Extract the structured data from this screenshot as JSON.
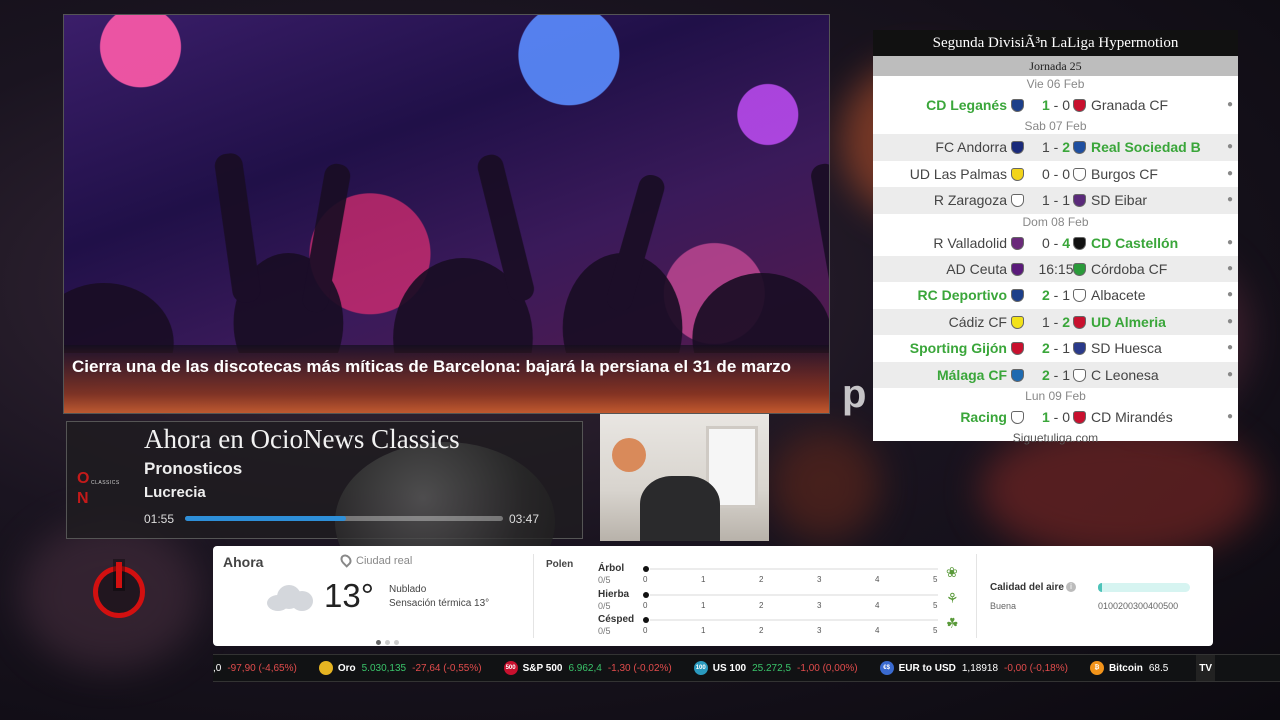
{
  "hero": {
    "headline": "Cierra una de las discotecas más míticas de Barcelona: bajará la persiana el 31 de marzo"
  },
  "now_playing": {
    "title": "Ahora en OcioNews Classics",
    "show": "Pronosticos",
    "host": "Lucrecia",
    "current_time": "01:55",
    "duration": "03:47",
    "progress_fraction": 0.506,
    "logo_o": "O",
    "logo_n": "N",
    "logo_classics": "CLASSICS"
  },
  "side_letter": "p",
  "laliga": {
    "title": "Segunda DivisiÃ³n LaLiga Hypermotion",
    "round": "Jornada 25",
    "footer": "Siguetuliga.com",
    "days": [
      {
        "date": "Vie 06 Feb",
        "matches": [
          {
            "home": "CD Leganés",
            "score": "1 - 0",
            "away": "Granada CF",
            "winner": "home",
            "home_color": "#1c3f8a",
            "away_color": "#c8102e"
          }
        ]
      },
      {
        "date": "Sab 07 Feb",
        "matches": [
          {
            "home": "FC Andorra",
            "score": "1 - 2",
            "away": "Real Sociedad B",
            "winner": "away",
            "home_color": "#1a2a7a",
            "away_color": "#1f4fa0"
          },
          {
            "home": "UD Las Palmas",
            "score": "0 - 0",
            "away": "Burgos CF",
            "winner": "none",
            "home_color": "#f2d41a",
            "away_color": "#ffffff"
          },
          {
            "home": "R Zaragoza",
            "score": "1 - 1",
            "away": "SD Eibar",
            "winner": "none",
            "home_color": "#ffffff",
            "away_color": "#5a2a7a"
          }
        ]
      },
      {
        "date": "Dom 08 Feb",
        "matches": [
          {
            "home": "R Valladolid",
            "score": "0 - 4",
            "away": "CD Castellón",
            "winner": "away",
            "home_color": "#6a2a7a",
            "away_color": "#111111"
          },
          {
            "home": "AD Ceuta",
            "score": "16:15",
            "away": "Córdoba CF",
            "winner": "none",
            "home_color": "#5a1a7a",
            "away_color": "#2a9a3a"
          },
          {
            "home": "RC Deportivo",
            "score": "2 - 1",
            "away": "Albacete",
            "winner": "home",
            "home_color": "#1c3f8a",
            "away_color": "#ffffff"
          },
          {
            "home": "Cádiz CF",
            "score": "1 - 2",
            "away": "UD Almeria",
            "winner": "away",
            "home_color": "#f2e21a",
            "away_color": "#c8102e"
          },
          {
            "home": "Sporting Gijón",
            "score": "2 - 1",
            "away": "SD Huesca",
            "winner": "home",
            "home_color": "#c8102e",
            "away_color": "#2a3a8a"
          },
          {
            "home": "Málaga CF",
            "score": "2 - 1",
            "away": "C Leonesa",
            "winner": "home",
            "home_color": "#1f6ab0",
            "away_color": "#ffffff"
          }
        ]
      },
      {
        "date": "Lun 09 Feb",
        "matches": [
          {
            "home": "Racing",
            "score": "1 - 0",
            "away": "CD Mirandés",
            "winner": "home",
            "home_color": "#ffffff",
            "away_color": "#c8102e"
          }
        ]
      }
    ]
  },
  "weather": {
    "now_label": "Ahora",
    "city": "Ciudad real",
    "temperature": "13°",
    "condition": "Nublado",
    "feels_like": "Sensación térmica 13°",
    "pollen_label": "Polen",
    "pollen": [
      {
        "name": "Árbol",
        "level": "0/5",
        "icon": "tree-icon"
      },
      {
        "name": "Hierba",
        "level": "0/5",
        "icon": "herb-icon"
      },
      {
        "name": "Césped",
        "level": "0/5",
        "icon": "grass-icon"
      }
    ],
    "pollen_ticks": [
      "0",
      "1",
      "2",
      "3",
      "4",
      "5"
    ],
    "air_quality_label": "Calidad del aire",
    "air_quality_value": "Buena",
    "air_scale": "0100200300400500",
    "info_glyph": "i"
  },
  "ticker": [
    {
      "name": "",
      "value": ",0",
      "change": "-97,90 (-4,65%)",
      "icon": "",
      "value_color": "white"
    },
    {
      "name": "Oro",
      "value": "5.030,135",
      "change": "-27,64 (-0,55%)",
      "icon": "gold-icon",
      "icon_text": "",
      "icon_color": "#e6b422",
      "value_color": "green"
    },
    {
      "name": "S&P 500",
      "value": "6.962,4",
      "change": "-1,30 (-0,02%)",
      "icon": "sp500-icon",
      "icon_text": "500",
      "icon_color": "#c8102e",
      "value_color": "green"
    },
    {
      "name": "US 100",
      "value": "25.272,5",
      "change": "-1,00 (0,00%)",
      "icon": "us100-icon",
      "icon_text": "100",
      "icon_color": "#2a9abf",
      "value_color": "green"
    },
    {
      "name": "EUR to USD",
      "value": "1,18918",
      "change": "-0,00 (-0,18%)",
      "icon": "eurusd-icon",
      "icon_text": "€$",
      "icon_color": "#3a6ad0",
      "value_color": "white"
    },
    {
      "name": "Bitcoin",
      "value": "68.5",
      "change": "",
      "icon": "bitcoin-icon",
      "icon_text": "₿",
      "icon_color": "#f2931a",
      "value_color": "white"
    }
  ],
  "ticker_badge": "TV"
}
